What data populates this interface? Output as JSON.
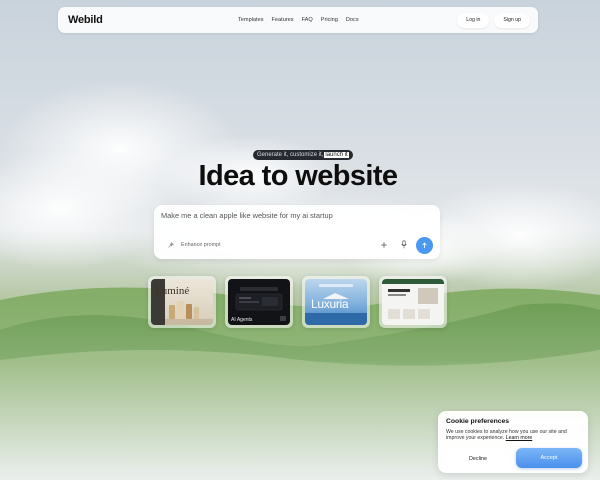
{
  "nav": {
    "logo": "Webild",
    "links": [
      "Templates",
      "Features",
      "FAQ",
      "Pricing",
      "Docs"
    ],
    "login": "Log in",
    "signup": "Sign up"
  },
  "hero": {
    "badge_prefix": "Generate it, customize it,",
    "badge_highlight": "launch it",
    "title": "Idea to website",
    "prompt_value": "Make me a clean apple like website for my ai startup",
    "enhance_label": "Enhance prompt"
  },
  "templates": [
    {
      "label": "Luminé"
    },
    {
      "label": "AI Agents"
    },
    {
      "label": "Luxuria"
    },
    {
      "label": ""
    }
  ],
  "cookie": {
    "title": "Cookie preferences",
    "text": "We use cookies to analyze how you use our site and improve your experience.",
    "link": "Learn more",
    "decline": "Decline",
    "accept": "Accept"
  },
  "icons": {
    "enhance": "sparkle-icon",
    "add": "plus-icon",
    "mic": "microphone-icon",
    "send": "arrow-up-icon"
  },
  "colors": {
    "accent": "#4a98ef",
    "badge_bg": "#262a30"
  }
}
